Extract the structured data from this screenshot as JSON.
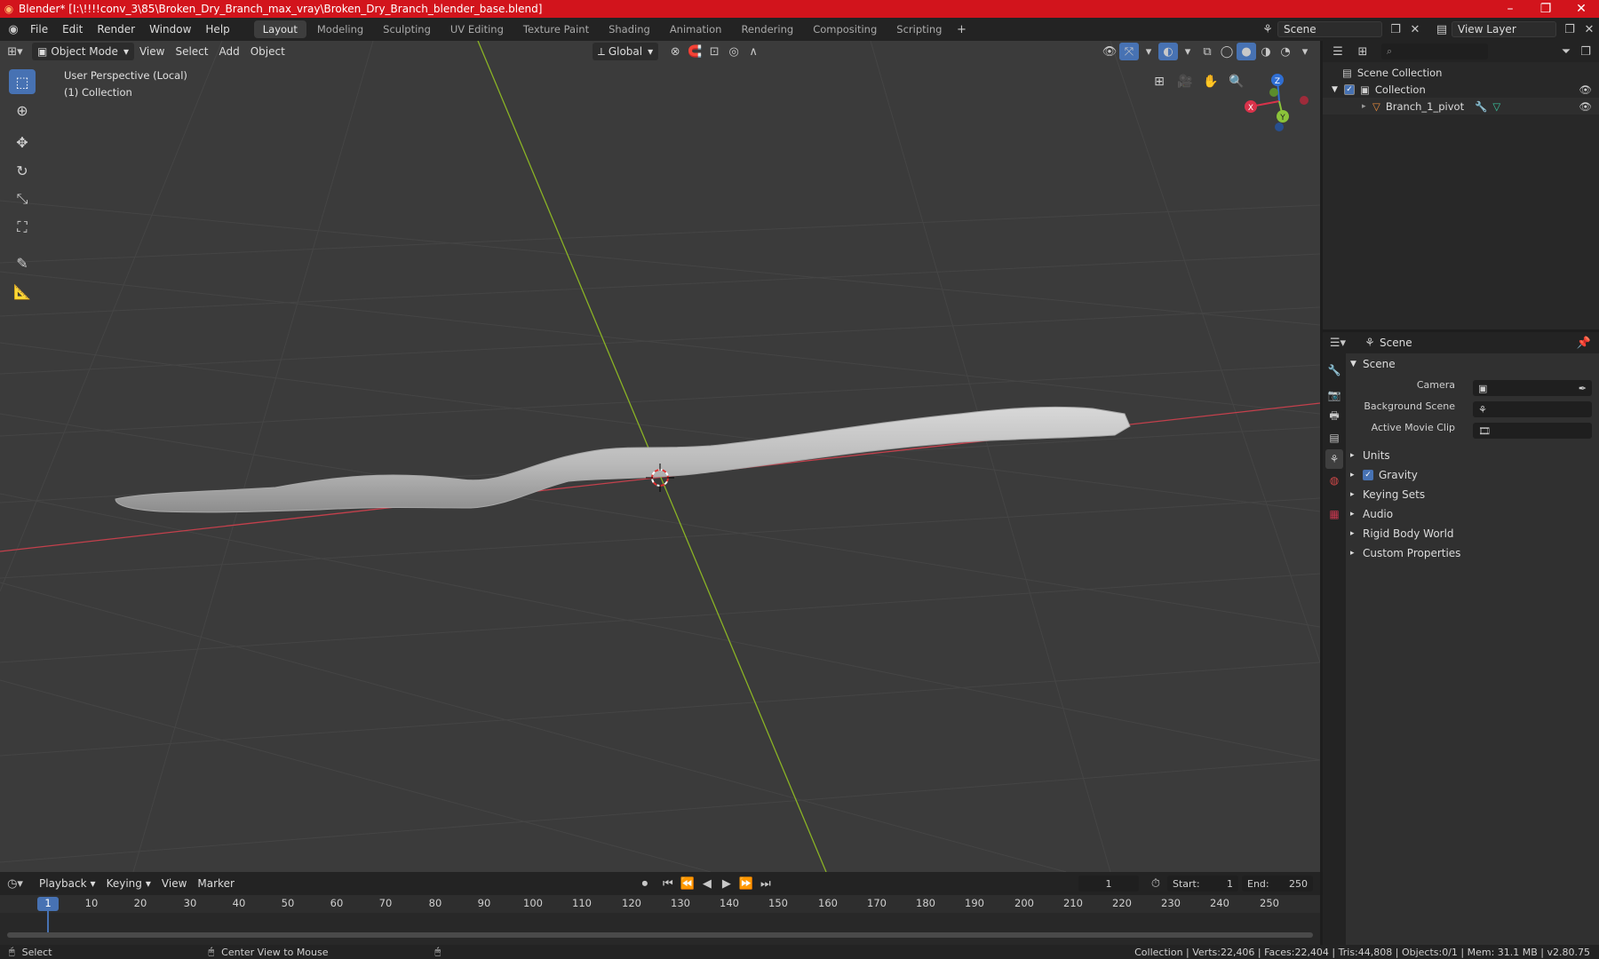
{
  "window": {
    "title": "Blender* [I:\\!!!!conv_3\\85\\Broken_Dry_Branch_max_vray\\Broken_Dry_Branch_blender_base.blend]",
    "controls": [
      "minimize-icon",
      "maximize-icon",
      "close-icon"
    ]
  },
  "menu": {
    "items": [
      "File",
      "Edit",
      "Render",
      "Window",
      "Help"
    ]
  },
  "workspaces": {
    "tabs": [
      "Layout",
      "Modeling",
      "Sculpting",
      "UV Editing",
      "Texture Paint",
      "Shading",
      "Animation",
      "Rendering",
      "Compositing",
      "Scripting"
    ],
    "active": "Layout"
  },
  "scene_selector": {
    "value": "Scene"
  },
  "view_layer_selector": {
    "value": "View Layer"
  },
  "viewport_header": {
    "mode": "Object Mode",
    "menus": [
      "View",
      "Select",
      "Add",
      "Object"
    ],
    "transform_orientation": "Global"
  },
  "viewport": {
    "perspective_label": "User Perspective (Local)",
    "collection_label": "(1) Collection",
    "gizmo_axes": [
      "X",
      "Y",
      "Z"
    ],
    "background_color": "#3b3b3b",
    "x_axis_color": "#c3404c",
    "y_axis_color": "#8ab325"
  },
  "tools": [
    "select-box-icon",
    "cursor-icon",
    "move-icon",
    "rotate-icon",
    "scale-icon",
    "transform-icon",
    "annotate-icon",
    "measure-icon"
  ],
  "outliner": {
    "search_placeholder": "",
    "rows": [
      {
        "label": "Scene Collection",
        "level": 0
      },
      {
        "label": "Collection",
        "level": 1
      },
      {
        "label": "Branch_1_pivot",
        "level": 2
      }
    ]
  },
  "properties": {
    "context_label": "Scene",
    "panel_title": "Scene",
    "fields": [
      {
        "label": "Camera",
        "value": ""
      },
      {
        "label": "Background Scene",
        "value": ""
      },
      {
        "label": "Active Movie Clip",
        "value": ""
      }
    ],
    "subpanels": [
      "Units",
      "Gravity",
      "Keying Sets",
      "Audio",
      "Rigid Body World",
      "Custom Properties"
    ],
    "gravity_enabled": true
  },
  "timeline": {
    "menus": [
      "Playback",
      "Keying",
      "View",
      "Marker"
    ],
    "current_frame": "1",
    "start_label": "Start:",
    "start_value": "1",
    "end_label": "End:",
    "end_value": "250",
    "frame_ticks": [
      "1",
      "10",
      "20",
      "30",
      "40",
      "50",
      "60",
      "70",
      "80",
      "90",
      "100",
      "110",
      "120",
      "130",
      "140",
      "150",
      "160",
      "170",
      "180",
      "190",
      "200",
      "210",
      "220",
      "230",
      "240",
      "250"
    ]
  },
  "statusbar": {
    "left_hint": "Select",
    "middle_hint": "Center View to Mouse",
    "stats": "Collection | Verts:22,406 | Faces:22,404 | Tris:44,808 | Objects:0/1 | Mem: 31.1 MB | v2.80.75"
  }
}
